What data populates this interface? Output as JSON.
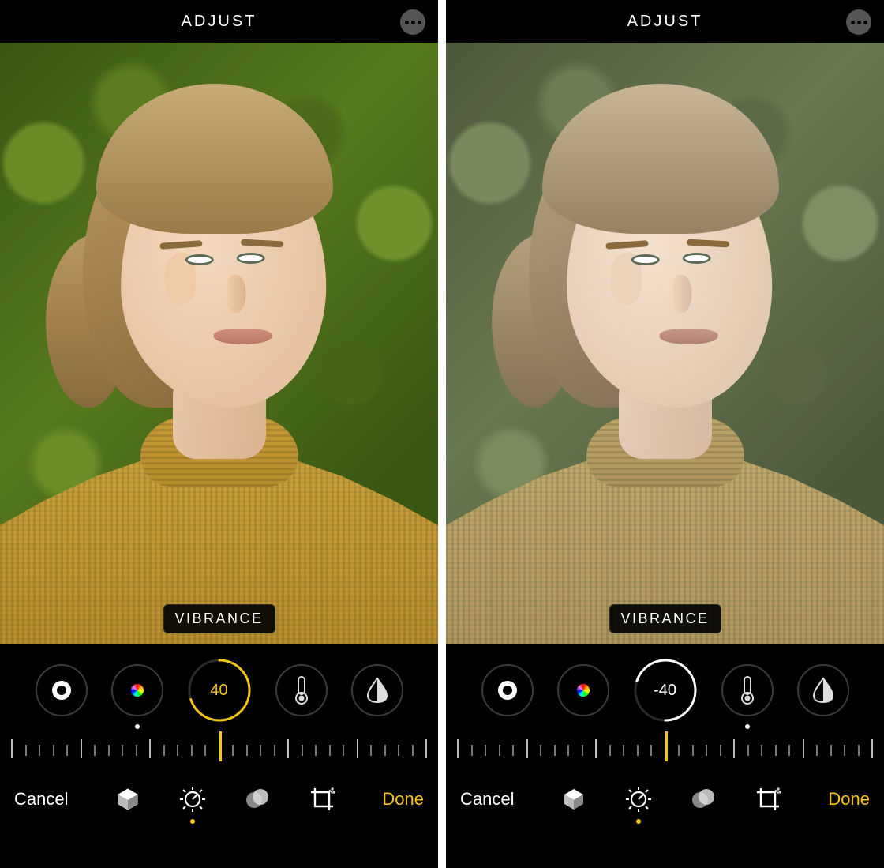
{
  "panes": [
    {
      "header": {
        "title": "ADJUST"
      },
      "param_label": "VIBRANCE",
      "active_value": "40",
      "active_value_color": "accent",
      "ring": {
        "progress": 0.7,
        "direction": "cw",
        "color": "#f5c518"
      },
      "indicator_percent": 50,
      "edited_dot_index": 1,
      "dials": [
        "contrast",
        "saturation",
        "vibrance",
        "warmth",
        "tint"
      ],
      "footer": {
        "cancel": "Cancel",
        "done": "Done",
        "active_tool": "adjust"
      }
    },
    {
      "header": {
        "title": "ADJUST"
      },
      "param_label": "VIBRANCE",
      "active_value": "-40",
      "active_value_color": "white",
      "ring": {
        "progress": 0.7,
        "direction": "ccw",
        "color": "#ffffff"
      },
      "indicator_percent": 50,
      "edited_dot_index": 3,
      "dials": [
        "contrast",
        "saturation",
        "vibrance",
        "warmth",
        "tint"
      ],
      "footer": {
        "cancel": "Cancel",
        "done": "Done",
        "active_tool": "adjust"
      }
    }
  ],
  "icons": {
    "contrast": "contrast-icon",
    "saturation": "saturation-icon",
    "vibrance": "vibrance-icon",
    "warmth": "warmth-icon",
    "tint": "tint-icon"
  },
  "colors": {
    "accent": "#f5c518",
    "bg": "#000000",
    "text": "#ffffff"
  }
}
